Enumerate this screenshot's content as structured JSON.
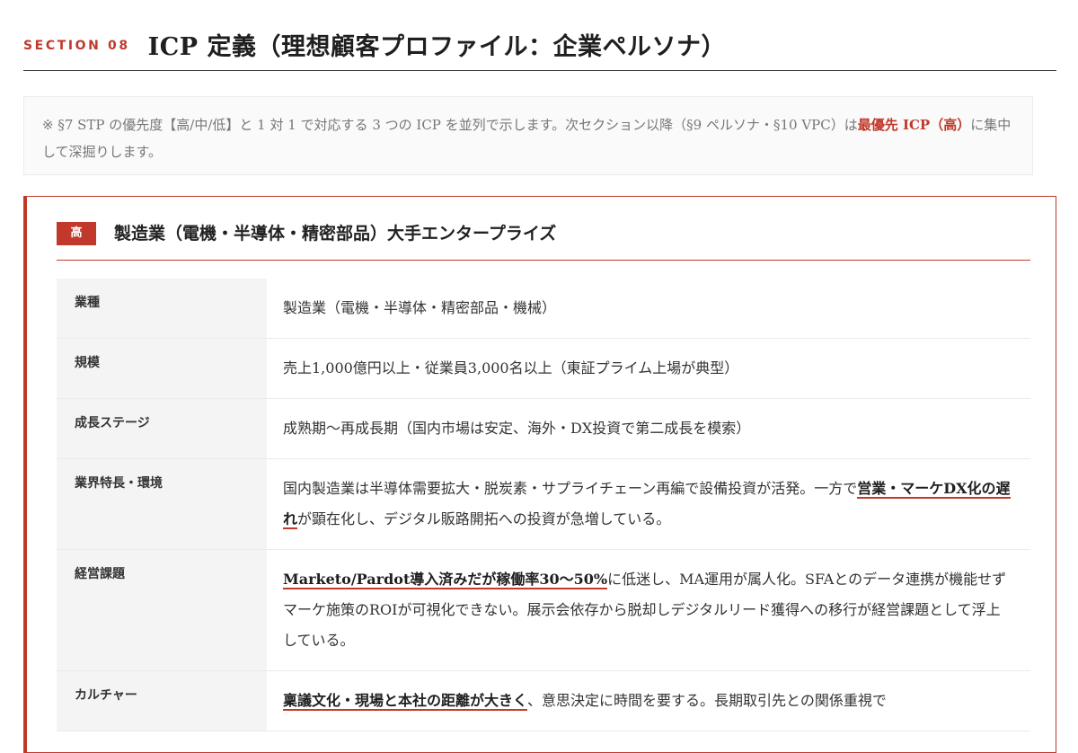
{
  "section": {
    "label": "SECTION 08",
    "title": "ICP 定義（理想顧客プロファイル：企業ペルソナ）"
  },
  "note": {
    "text_before": "※ §7 STP の優先度【高/中/低】と 1 対 1 で対応する 3 つの ICP を並列で示します。次セクション以降（§9 ペルソナ・§10 VPC）は",
    "strong": "最優先 ICP（高）",
    "text_after": "に集中して深掘りします。"
  },
  "icp": {
    "badge": "高",
    "title": "製造業（電機・半導体・精密部品）大手エンタープライズ",
    "accent_color": "#c0392b",
    "rows": [
      {
        "label": "業種",
        "text": "製造業（電機・半導体・精密部品・機械）"
      },
      {
        "label": "規模",
        "text": "売上1,000億円以上・従業員3,000名以上（東証プライム上場が典型）"
      },
      {
        "label": "成長ステージ",
        "text": "成熟期〜再成長期（国内市場は安定、海外・DX投資で第二成長を模索）"
      },
      {
        "label": "業界特長・環境",
        "text_before": "国内製造業は半導体需要拡大・脱炭素・サプライチェーン再編で設備投資が活発。一方で",
        "highlight": "営業・マーケDX化の遅れ",
        "text_after": "が顕在化し、デジタル販路開拓への投資が急増している。"
      },
      {
        "label": "経営課題",
        "highlight": "Marketo/Pardot導入済みだが稼働率30〜50%",
        "text_after": "に低迷し、MA運用が属人化。SFAとのデータ連携が機能せずマーケ施策のROIが可視化できない。展示会依存から脱却しデジタルリード獲得への移行が経営課題として浮上している。"
      },
      {
        "label": "カルチャー",
        "highlight": "稟議文化・現場と本社の距離が大きく",
        "text_after": "、意思決定に時間を要する。長期取引先との関係重視で"
      }
    ]
  }
}
